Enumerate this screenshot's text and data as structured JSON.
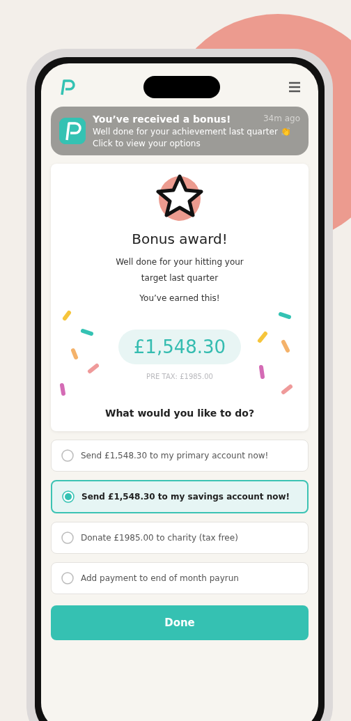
{
  "notification": {
    "title": "You’ve received a bonus!",
    "time": "34m ago",
    "message": "Well done for your achievement last quarter 👏",
    "hint": "Click to view your options"
  },
  "award": {
    "title": "Bonus award!",
    "message": "Well done for your hitting your target last quarter",
    "subtitle": "You’ve earned this!",
    "amount": "£1,548.30",
    "pre_tax": "PRE TAX: £1985.00",
    "question": "What would you like to do?"
  },
  "options": [
    {
      "label": "Send £1,548.30 to my primary account now!",
      "selected": false
    },
    {
      "label": "Send £1,548.30 to my savings account now!",
      "selected": true
    },
    {
      "label": "Donate £1985.00 to charity (tax free)",
      "selected": false
    },
    {
      "label": "Add payment to end of month payrun",
      "selected": false
    }
  ],
  "button": "Done"
}
